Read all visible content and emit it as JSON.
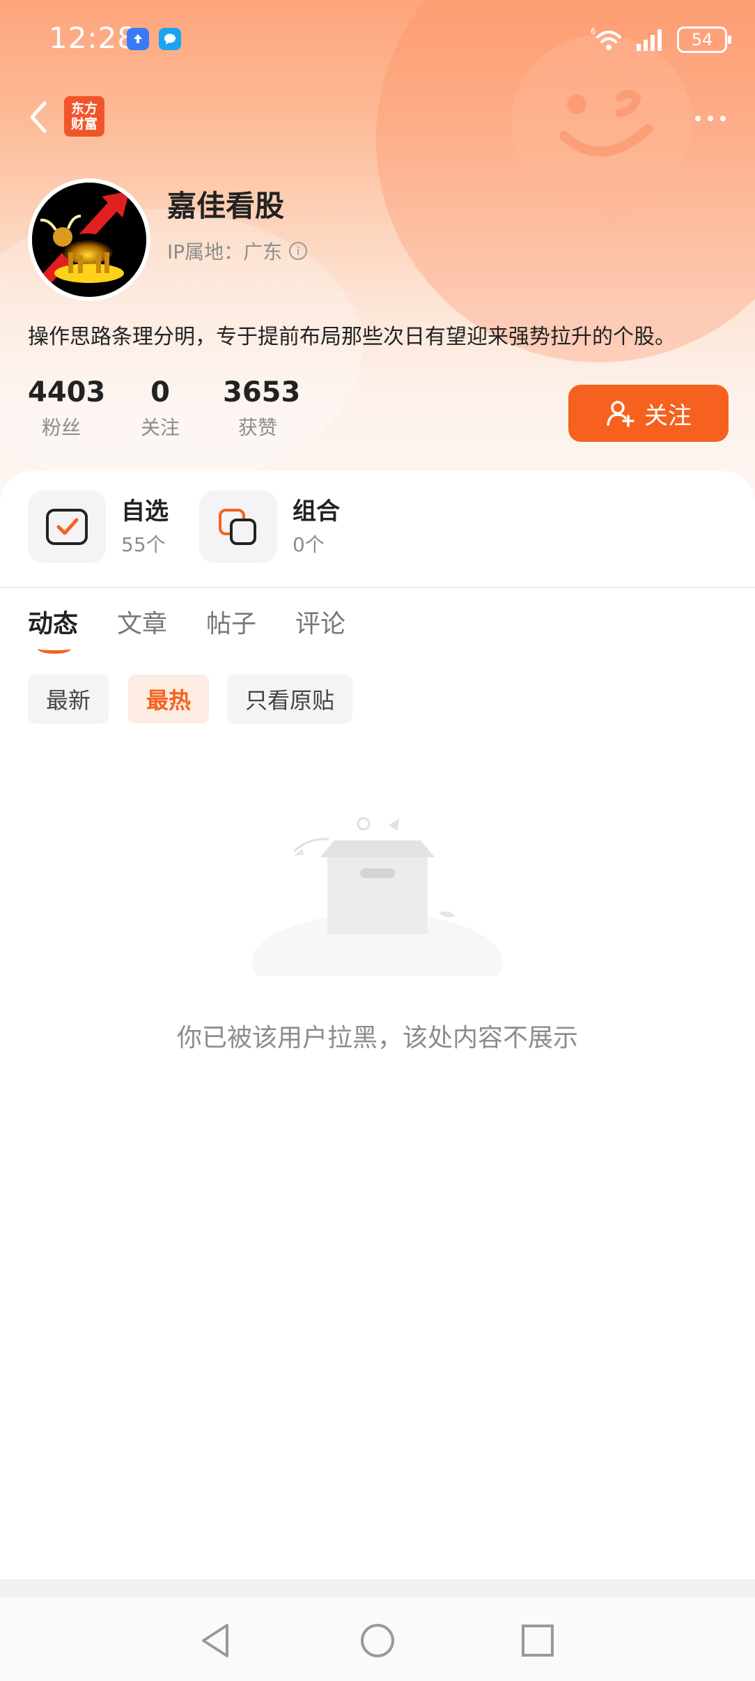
{
  "status_bar": {
    "time": "12:28",
    "battery": "54",
    "network": "6",
    "app_icons": [
      "upload-icon",
      "message-icon"
    ]
  },
  "nav": {
    "logo_line1": "东方",
    "logo_line2": "财富"
  },
  "profile": {
    "username": "嘉佳看股",
    "ip_location": "IP属地：广东",
    "bio": "操作思路条理分明，专于提前布局那些次日有望迎来强势拉升的个股。",
    "stats": [
      {
        "value": "4403",
        "label": "粉丝"
      },
      {
        "value": "0",
        "label": "关注"
      },
      {
        "value": "3653",
        "label": "获赞"
      }
    ],
    "follow_label": "关注"
  },
  "features": [
    {
      "title": "自选",
      "sub": "55个",
      "icon": "checkbox-icon"
    },
    {
      "title": "组合",
      "sub": "0个",
      "icon": "layers-icon"
    }
  ],
  "tabs": [
    {
      "label": "动态",
      "active": true
    },
    {
      "label": "文章",
      "active": false
    },
    {
      "label": "帖子",
      "active": false
    },
    {
      "label": "评论",
      "active": false
    }
  ],
  "filters": [
    {
      "label": "最新",
      "active": false
    },
    {
      "label": "最热",
      "active": true
    },
    {
      "label": "只看原贴",
      "active": false
    }
  ],
  "empty_state": {
    "message": "你已被该用户拉黑，该处内容不展示"
  },
  "colors": {
    "accent": "#f6611f",
    "hero_top": "#fda57c",
    "muted_text": "#8c8c8c"
  }
}
